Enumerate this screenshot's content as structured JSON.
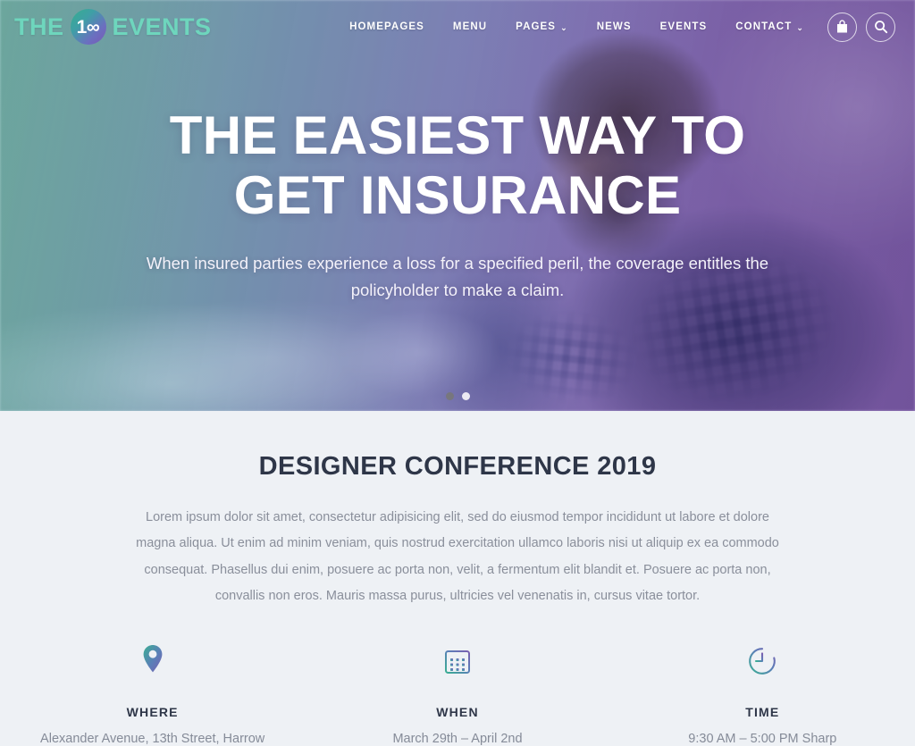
{
  "header": {
    "logo": {
      "text_before": "THE",
      "badge": "1∞",
      "text_after": "EVENTS"
    },
    "nav": [
      {
        "label": "HOMEPAGES",
        "has_dropdown": false,
        "name": "nav-homepages"
      },
      {
        "label": "MENU",
        "has_dropdown": false,
        "name": "nav-menu"
      },
      {
        "label": "PAGES",
        "has_dropdown": true,
        "name": "nav-pages"
      },
      {
        "label": "NEWS",
        "has_dropdown": false,
        "name": "nav-news"
      },
      {
        "label": "EVENTS",
        "has_dropdown": false,
        "name": "nav-events"
      },
      {
        "label": "CONTACT",
        "has_dropdown": true,
        "name": "nav-contact"
      }
    ],
    "chevron": "⌄",
    "cart_icon": "shopping-bag-icon",
    "search_icon": "search-icon"
  },
  "hero": {
    "title_line1": "THE EASIEST WAY TO",
    "title_line2": "GET INSURANCE",
    "subtitle": "When insured parties experience a loss for a specified peril, the coverage entitles the policyholder to make a claim.",
    "slides": [
      {
        "active": false
      },
      {
        "active": true
      }
    ]
  },
  "event": {
    "title": "DESIGNER CONFERENCE 2019",
    "description": "Lorem ipsum dolor sit amet, consectetur adipisicing elit, sed do eiusmod tempor incididunt ut labore et dolore magna aliqua. Ut enim ad minim veniam, quis nostrud exercitation ullamco laboris nisi ut aliquip ex ea commodo consequat. Phasellus dui enim, posuere ac porta non, velit, a fermentum elit blandit et. Posuere ac porta non, convallis non eros. Mauris massa purus, ultricies vel venenatis in, cursus vitae tortor.",
    "columns": [
      {
        "icon": "map-pin-icon",
        "label": "WHERE",
        "value": "Alexander Avenue, 13th Street, Harrow"
      },
      {
        "icon": "calendar-icon",
        "label": "WHEN",
        "value": "March 29th – April 2nd"
      },
      {
        "icon": "clock-icon",
        "label": "TIME",
        "value": "9:30 AM – 5:00 PM Sharp"
      }
    ]
  },
  "colors": {
    "brand_teal": "#6ed6bd",
    "brand_purple": "#7a58b5",
    "heading": "#2e3648",
    "body_text": "#8a8f9b",
    "section_bg": "#eef1f5"
  }
}
